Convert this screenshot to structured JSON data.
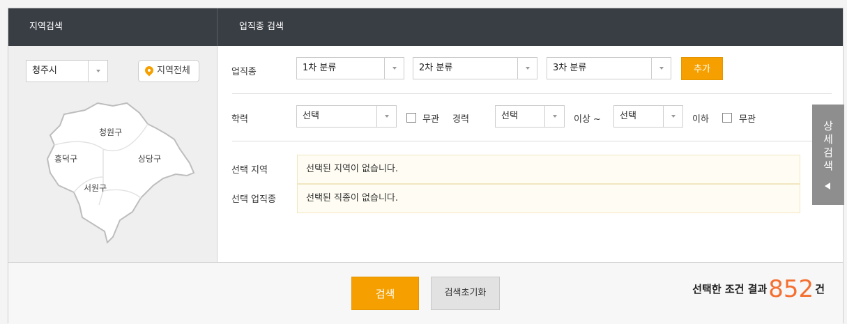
{
  "header": {
    "region_title": "지역검색",
    "job_title": "업직종 검색"
  },
  "region": {
    "city_select": "청주시",
    "all_region_button": "지역전체",
    "districts": [
      "청원구",
      "흥덕구",
      "상당구",
      "서원구"
    ]
  },
  "job": {
    "label": "업직종",
    "cat1": "1차 분류",
    "cat2": "2차 분류",
    "cat3": "3차 분류",
    "add_button": "추가"
  },
  "edu": {
    "label": "학력",
    "select": "선택",
    "nocare": "무관",
    "career_label": "경력",
    "career_min": "선택",
    "above": "이상 ~",
    "career_max": "선택",
    "below": "이하",
    "nocare2": "무관"
  },
  "selected": {
    "region_label": "선택 지역",
    "region_text": "선택된 지역이 없습니다.",
    "job_label": "선택 업직종",
    "job_text": "선택된 직종이 없습니다."
  },
  "side_tab": {
    "chars": [
      "상",
      "세",
      "검",
      "색"
    ]
  },
  "footer": {
    "search_button": "검색",
    "reset_button": "검색초기화",
    "result_prefix": "선택한 조건 결과",
    "result_count": "852",
    "result_suffix": "건"
  },
  "colors": {
    "accent": "#f5a000",
    "header_bg": "#393d44",
    "count": "#f46f30"
  }
}
